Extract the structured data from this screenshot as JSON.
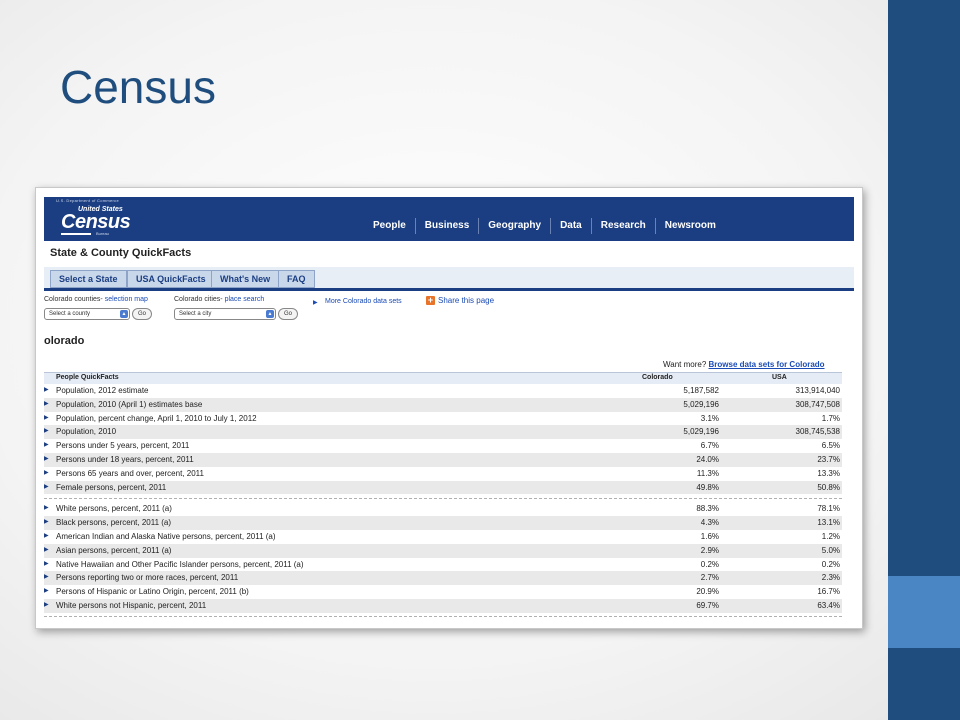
{
  "slide": {
    "title": "Census"
  },
  "header": {
    "logo_small": "U.S. Department of Commerce",
    "logo_us": "United States",
    "logo_census": "Census",
    "logo_bureau": "Bureau",
    "nav": [
      "People",
      "Business",
      "Geography",
      "Data",
      "Research",
      "Newsroom"
    ]
  },
  "page": {
    "title": "State & County QuickFacts",
    "tabs": [
      "Select a State",
      "USA QuickFacts",
      "What's New",
      "FAQ"
    ],
    "counties_label": "Colorado counties-",
    "counties_link": "selection map",
    "cities_label": "Colorado cities-",
    "cities_link": "place search",
    "county_select": "Select a county",
    "city_select": "Select a city",
    "go": "Go",
    "more_link": "More Colorado data sets",
    "share": "Share this page",
    "state_name": "olorado",
    "want_more": "Want more?",
    "browse_link": "Browse data sets for Colorado"
  },
  "table": {
    "headers": {
      "label": "People QuickFacts",
      "col1": "Colorado",
      "col2": "USA"
    },
    "group1": [
      {
        "label": "Population, 2012 estimate",
        "co": "5,187,582",
        "usa": "313,914,040"
      },
      {
        "label": "Population, 2010 (April 1) estimates base",
        "co": "5,029,196",
        "usa": "308,747,508"
      },
      {
        "label": "Population, percent change, April 1, 2010 to July 1, 2012",
        "co": "3.1%",
        "usa": "1.7%"
      },
      {
        "label": "Population, 2010",
        "co": "5,029,196",
        "usa": "308,745,538"
      },
      {
        "label": "Persons under 5 years, percent, 2011",
        "co": "6.7%",
        "usa": "6.5%"
      },
      {
        "label": "Persons under 18 years, percent, 2011",
        "co": "24.0%",
        "usa": "23.7%"
      },
      {
        "label": "Persons 65 years and over, percent, 2011",
        "co": "11.3%",
        "usa": "13.3%"
      },
      {
        "label": "Female persons, percent, 2011",
        "co": "49.8%",
        "usa": "50.8%"
      }
    ],
    "group2": [
      {
        "label": "White persons, percent, 2011 (a)",
        "co": "88.3%",
        "usa": "78.1%"
      },
      {
        "label": "Black persons, percent, 2011 (a)",
        "co": "4.3%",
        "usa": "13.1%"
      },
      {
        "label": "American Indian and Alaska Native persons, percent, 2011 (a)",
        "co": "1.6%",
        "usa": "1.2%"
      },
      {
        "label": "Asian persons, percent, 2011 (a)",
        "co": "2.9%",
        "usa": "5.0%"
      },
      {
        "label": "Native Hawaiian and Other Pacific Islander persons, percent, 2011 (a)",
        "co": "0.2%",
        "usa": "0.2%"
      },
      {
        "label": "Persons reporting two or more races, percent, 2011",
        "co": "2.7%",
        "usa": "2.3%"
      },
      {
        "label": "Persons of Hispanic or Latino Origin, percent, 2011 (b)",
        "co": "20.9%",
        "usa": "16.7%"
      },
      {
        "label": "White persons not Hispanic, percent, 2011",
        "co": "69.7%",
        "usa": "63.4%"
      }
    ]
  }
}
